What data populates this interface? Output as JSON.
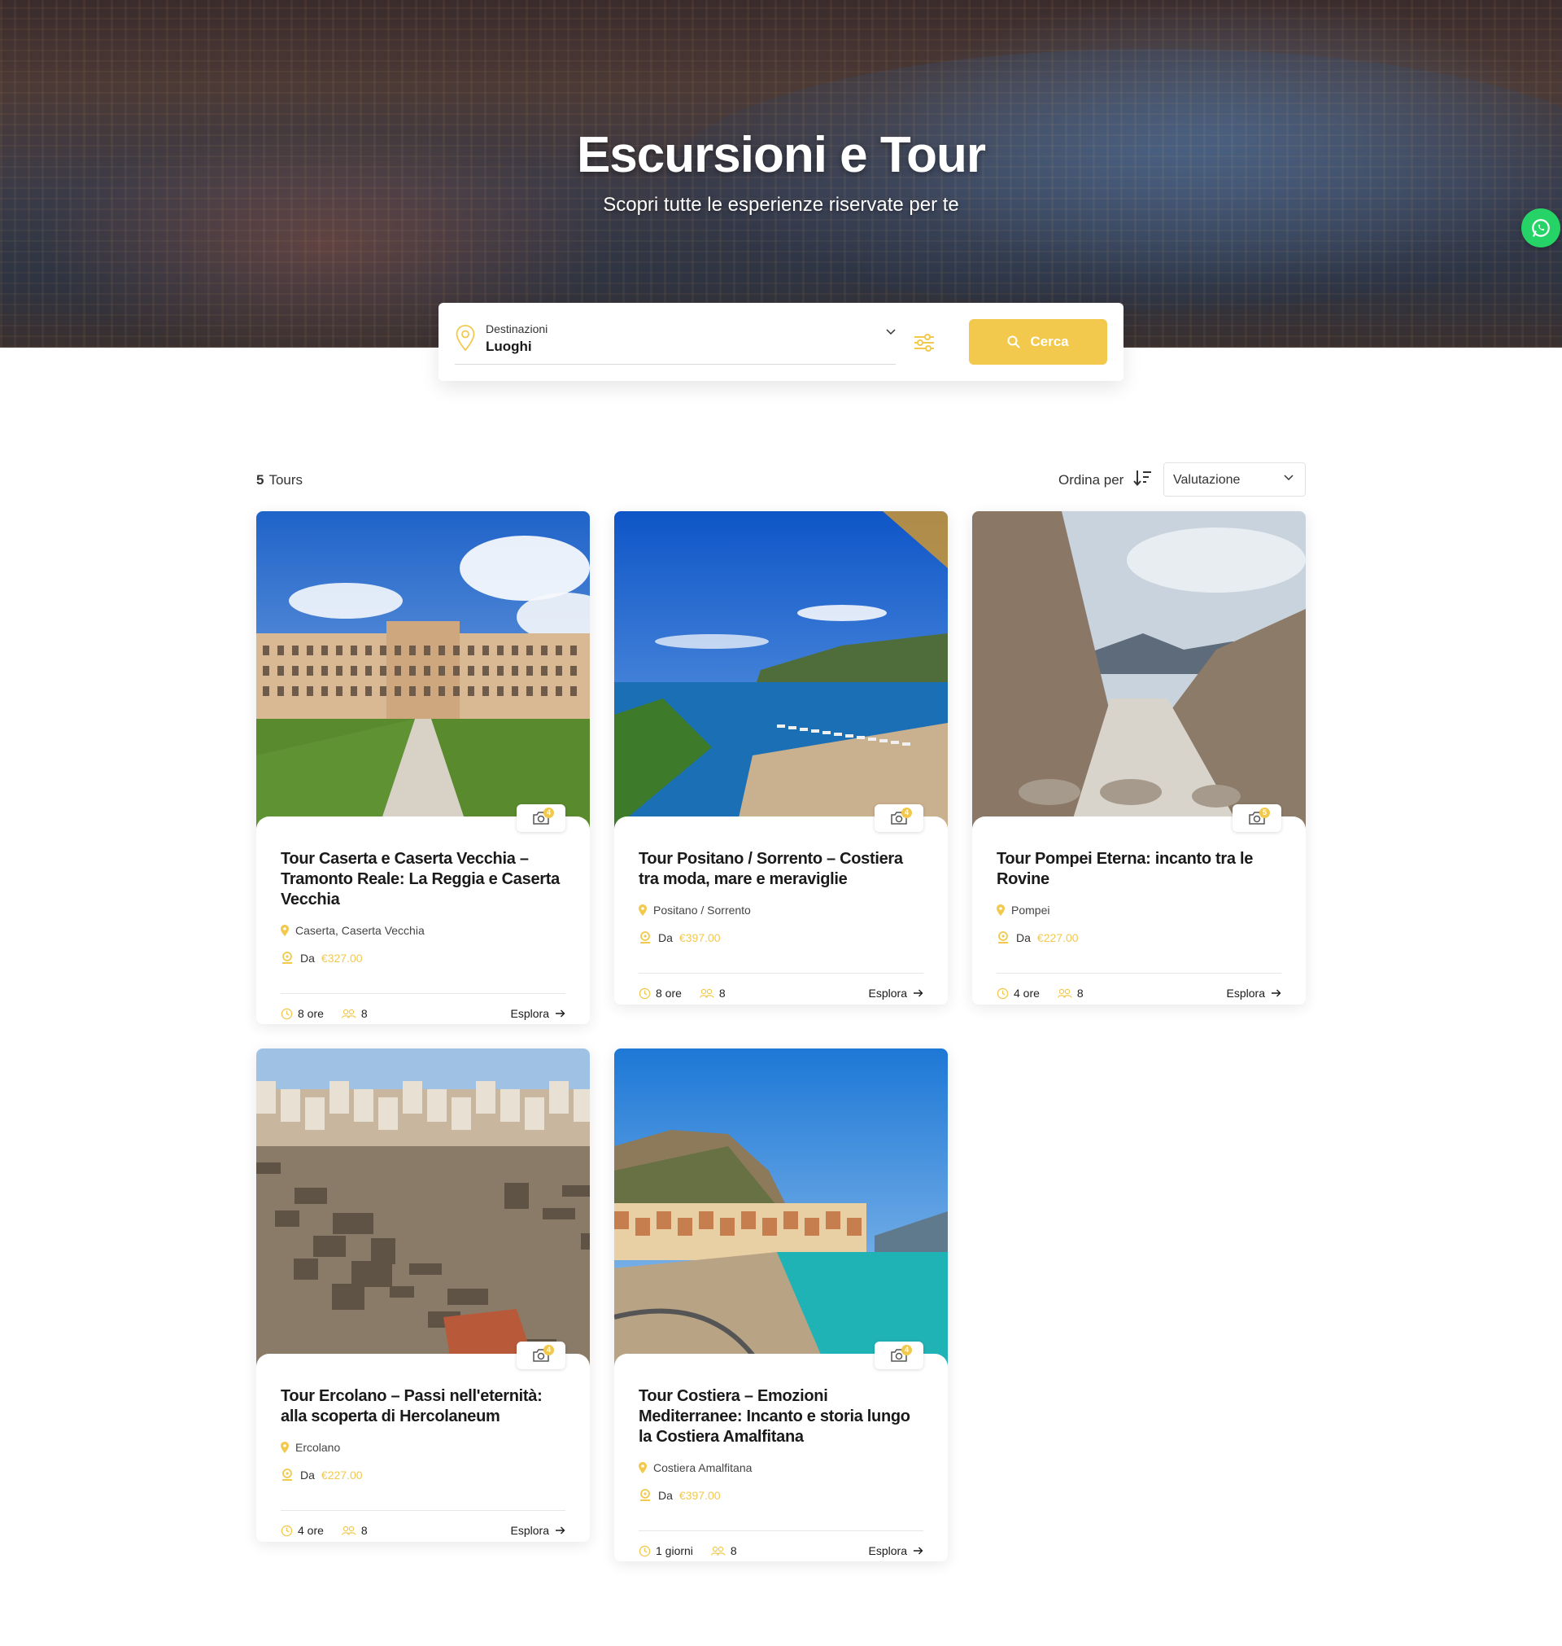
{
  "hero": {
    "title": "Escursioni e Tour",
    "subtitle": "Scopri tutte le esperienze riservate per te"
  },
  "search": {
    "destination_label": "Destinazioni",
    "destination_value": "Luoghi",
    "button_label": "Cerca",
    "icons": [
      "map-pin-icon",
      "chevron-down-icon",
      "sliders-icon",
      "search-icon"
    ]
  },
  "results": {
    "count": "5",
    "label": "Tours"
  },
  "sort": {
    "label": "Ordina per",
    "selected": "Valutazione"
  },
  "tours": [
    {
      "title": "Tour Caserta e Caserta Vecchia – Tramonto Reale: La Reggia e Caserta Vecchia",
      "location": "Caserta, Caserta Vecchia",
      "price_prefix": "Da",
      "price": "€327.00",
      "duration": "8 ore",
      "group": "8",
      "explore": "Esplora",
      "gallery_count": "4",
      "image": "reggia-di-caserta"
    },
    {
      "title": "Tour Positano / Sorrento – Costiera tra moda, mare e meraviglie",
      "location": "Positano / Sorrento",
      "price_prefix": "Da",
      "price": "€397.00",
      "duration": "8 ore",
      "group": "8",
      "explore": "Esplora",
      "gallery_count": "4",
      "image": "sorrento-coast"
    },
    {
      "title": "Tour Pompei Eterna: incanto tra le Rovine",
      "location": "Pompei",
      "price_prefix": "Da",
      "price": "€227.00",
      "duration": "4 ore",
      "group": "8",
      "explore": "Esplora",
      "gallery_count": "5",
      "image": "pompeii-street"
    },
    {
      "title": "Tour Ercolano – Passi nell'eternità: alla scoperta di Hercolaneum",
      "location": "Ercolano",
      "price_prefix": "Da",
      "price": "€227.00",
      "duration": "4 ore",
      "group": "8",
      "explore": "Esplora",
      "gallery_count": "4",
      "image": "herculaneum-ruins"
    },
    {
      "title": "Tour Costiera – Emozioni Mediterranee: Incanto e storia lungo la Costiera Amalfitana",
      "location": "Costiera Amalfitana",
      "price_prefix": "Da",
      "price": "€397.00",
      "duration": "1 giorni",
      "group": "8",
      "explore": "Esplora",
      "gallery_count": "4",
      "image": "atrani-amalfi"
    }
  ],
  "colors": {
    "accent": "#f2c94c",
    "whatsapp": "#25d366",
    "text": "#1a1a1a"
  }
}
